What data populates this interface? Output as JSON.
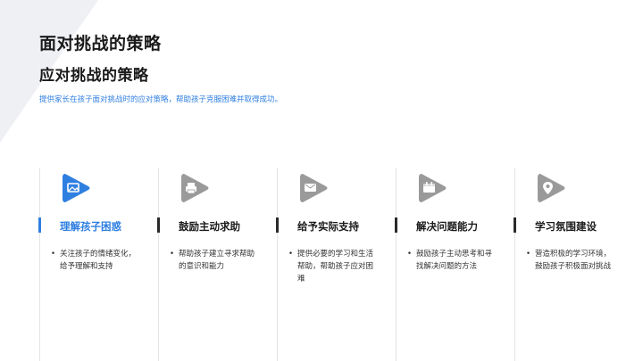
{
  "title": "面对挑战的策略",
  "subtitle": "应对挑战的策略",
  "description": "提供家长在孩子面对挑战时的应对策略，帮助孩子克服困难并取得成功。",
  "colors": {
    "accent": "#2f7fe0",
    "inactive_icon": "#9a9a9a"
  },
  "cards": [
    {
      "name": "理解孩子困惑",
      "body": "关注孩子的情绪变化，给予理解和支持",
      "icon": "image-icon",
      "active": true
    },
    {
      "name": "鼓励主动求助",
      "body": "帮助孩子建立寻求帮助的意识和能力",
      "icon": "printer-icon",
      "active": false
    },
    {
      "name": "给予实际支持",
      "body": "提供必要的学习和生活帮助，帮助孩子应对困难",
      "icon": "message-icon",
      "active": false
    },
    {
      "name": "解决问题能力",
      "body": "鼓励孩子主动思考和寻找解决问题的方法",
      "icon": "calendar-icon",
      "active": false
    },
    {
      "name": "学习氛围建设",
      "body": "营造积极的学习环境，鼓励孩子积极面对挑战",
      "icon": "location-icon",
      "active": false
    }
  ]
}
